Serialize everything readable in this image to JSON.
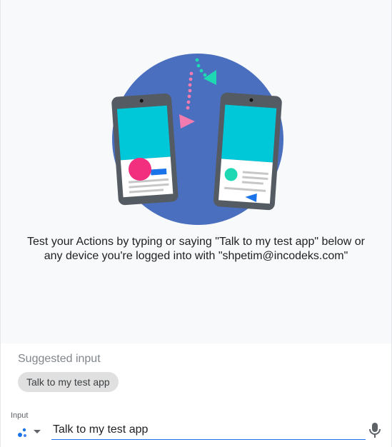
{
  "main": {
    "message_line1": "Test your Actions by typing or saying \"Talk to my test app\" below or",
    "message_line2": "any device you're logged into with \"shpetim@incodeks.com\""
  },
  "suggested": {
    "title": "Suggested input",
    "chips": [
      {
        "label": "Talk to my test app"
      }
    ]
  },
  "input": {
    "label": "Input",
    "value": "Talk to my test app"
  },
  "icons": {
    "assistant": "assistant-dots-icon",
    "dropdown": "caret-down-icon",
    "mic": "microphone-icon"
  },
  "colors": {
    "circle": "#4a6fbf",
    "screen": "#00c8d9",
    "pink": "#f22f7f",
    "teal": "#1ed8b4",
    "accent_blue": "#1a73e8"
  }
}
